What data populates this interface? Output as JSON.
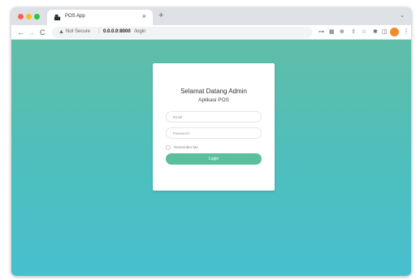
{
  "browser": {
    "tab": {
      "title": "POS App",
      "close": "×"
    },
    "new_tab": "+",
    "tab_chevron": "⌄",
    "nav": {
      "back": "←",
      "forward": "→",
      "reload": "C"
    },
    "address_bar": {
      "warning_icon": "▲",
      "security_label": "Not Secure",
      "separator": "|",
      "host": "0.0.0.0:8000",
      "path": "/login"
    },
    "toolbar_icons": [
      "key-icon",
      "translate-icon",
      "zoom-icon",
      "share-icon",
      "star-icon",
      "extensions-icon",
      "sidebar-icon"
    ],
    "toolbar_glyphs": {
      "key": "⊶",
      "translate": "▦",
      "zoom": "⊕",
      "share": "⇧",
      "star": "☆",
      "extensions": "✱",
      "sidebar": "◫",
      "menu": "⋮"
    },
    "colors": {
      "tab_bar": "#dee1e6",
      "profile": "#f28b2c"
    }
  },
  "page": {
    "background_gradient": [
      "#5fbea7",
      "#47bfce"
    ],
    "login_card": {
      "title": "Selamat Datang Admin",
      "subtitle": "Aplikasi POS",
      "email_placeholder": "Email",
      "password_placeholder": "Password",
      "remember_label": "Remember Me",
      "login_button": "Login",
      "button_color": "#5bbf9e"
    }
  }
}
